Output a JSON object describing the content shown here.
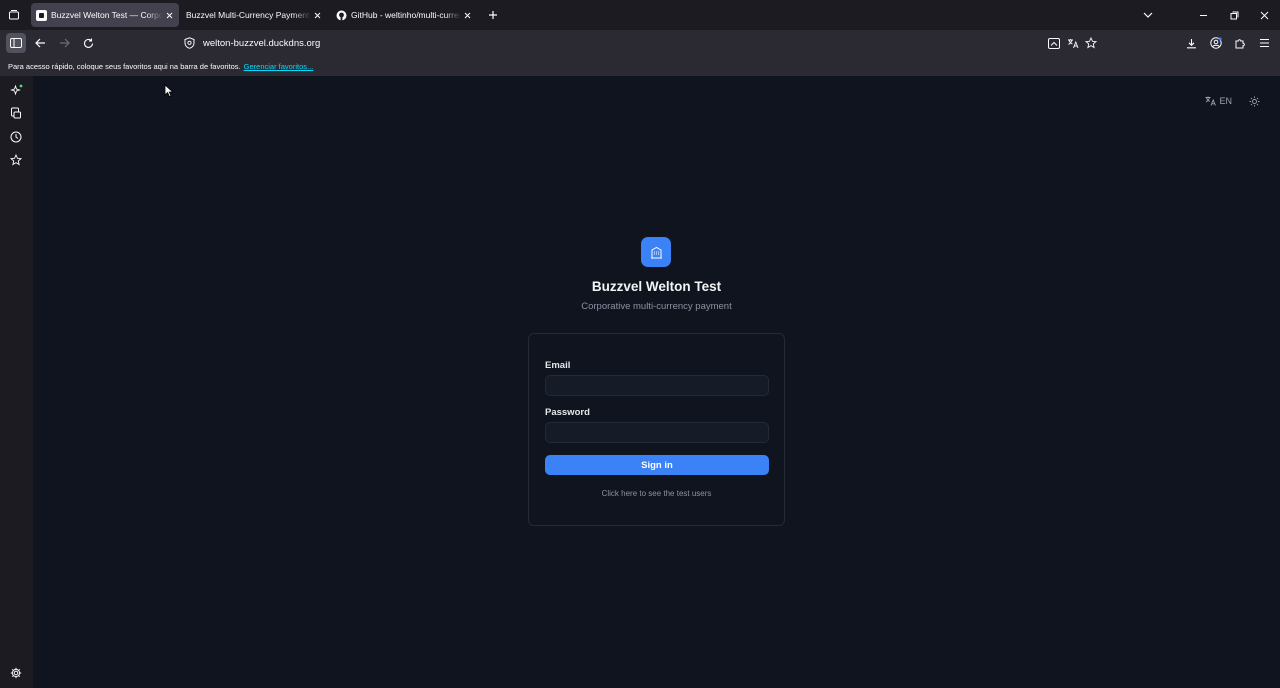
{
  "browser": {
    "tabs": [
      {
        "title": "Buzzvel Welton Test — Corporate multi-currency payment",
        "active": true,
        "favicon": "app-icon"
      },
      {
        "title": "Buzzvel Multi-Currency Payments API",
        "active": false,
        "favicon": "none"
      },
      {
        "title": "GitHub - weltinho/multi-currency-payments",
        "active": false,
        "favicon": "github-icon"
      }
    ],
    "url": "welton-buzzvel.duckdns.org",
    "bookmarks_message": "Para acesso rápido, coloque seus favoritos aqui na barra de favoritos.",
    "bookmarks_link": "Gerenciar favoritos..."
  },
  "page": {
    "language": "EN",
    "app_title": "Buzzvel Welton Test",
    "app_subtitle": "Corporative multi-currency payment",
    "form": {
      "email_label": "Email",
      "email_value": "",
      "password_label": "Password",
      "password_value": "",
      "signin_label": "Sign in",
      "test_users_link": "Click here to see the test users"
    }
  },
  "colors": {
    "accent": "#3b82f6",
    "page_bg": "#0f141f",
    "browser_chrome": "#2b2a33"
  }
}
